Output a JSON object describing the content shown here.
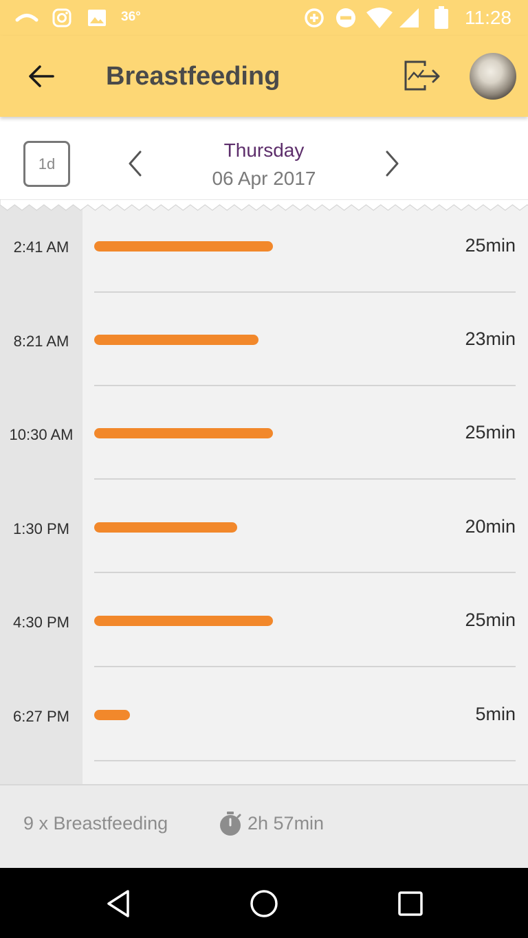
{
  "status_bar": {
    "temperature": "36°",
    "time": "11:28",
    "icons": [
      "wave-icon",
      "instagram-icon",
      "image-icon",
      "data-saver-icon",
      "do-not-disturb-icon",
      "wifi-icon",
      "signal-icon",
      "battery-icon"
    ]
  },
  "app_bar": {
    "title": "Breastfeeding",
    "back_icon": "arrow-left-icon",
    "export_icon": "export-chart-icon"
  },
  "date_nav": {
    "range_label": "1d",
    "day_name": "Thursday",
    "date": "06 Apr 2017"
  },
  "entries": [
    {
      "time": "2:41 AM",
      "duration": "25min",
      "minutes": 25
    },
    {
      "time": "8:21 AM",
      "duration": "23min",
      "minutes": 23
    },
    {
      "time": "10:30 AM",
      "duration": "25min",
      "minutes": 25
    },
    {
      "time": "1:30 PM",
      "duration": "20min",
      "minutes": 20
    },
    {
      "time": "4:30 PM",
      "duration": "25min",
      "minutes": 25
    },
    {
      "time": "6:27 PM",
      "duration": "5min",
      "minutes": 5
    }
  ],
  "colors": {
    "app_bar": "#fdd775",
    "duration_bar": "#f2882b",
    "day_name": "#5d2e6b"
  },
  "summary": {
    "count": "9 x Breastfeeding",
    "total": "2h 57min"
  }
}
